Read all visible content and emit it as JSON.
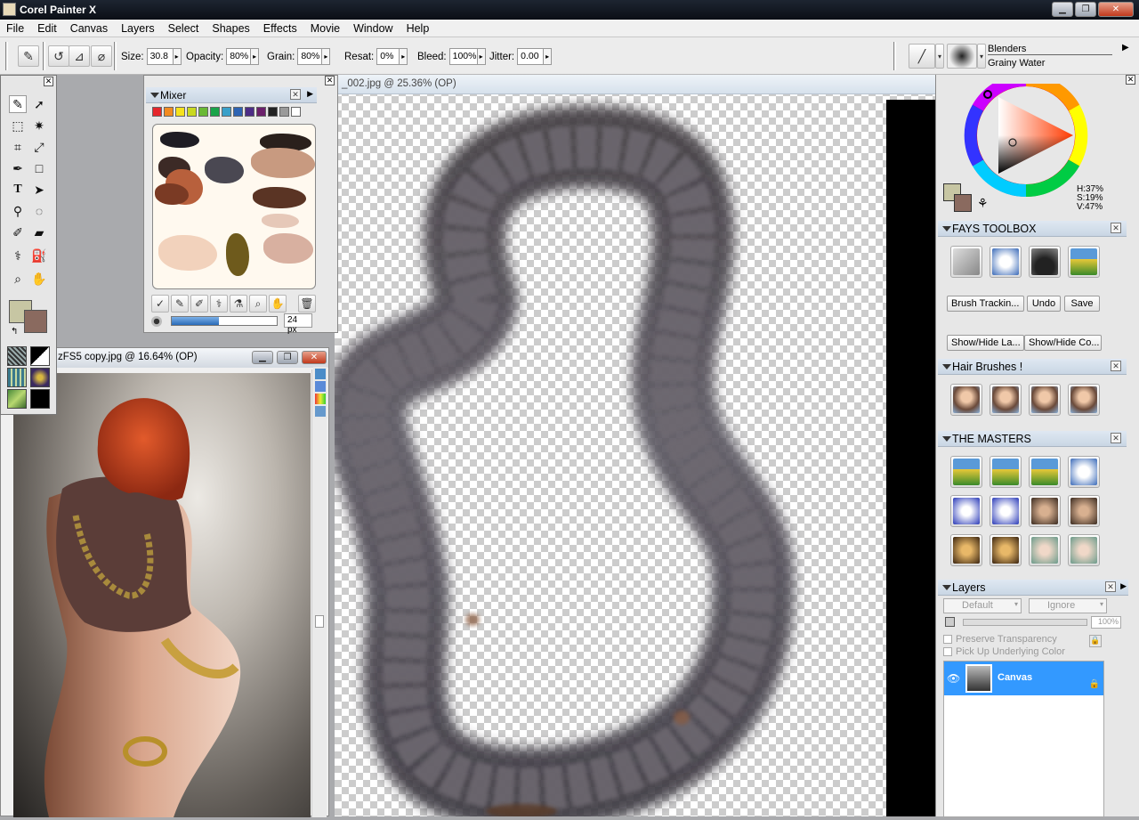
{
  "app": {
    "title": "Corel Painter X"
  },
  "menu": [
    "File",
    "Edit",
    "Canvas",
    "Layers",
    "Select",
    "Shapes",
    "Effects",
    "Movie",
    "Window",
    "Help"
  ],
  "propbar": {
    "size_label": "Size:",
    "size": "30.8",
    "opacity_label": "Opacity:",
    "opacity": "80%",
    "grain_label": "Grain:",
    "grain": "80%",
    "resat_label": "Resat:",
    "resat": "0%",
    "bleed_label": "Bleed:",
    "bleed": "100%",
    "jitter_label": "Jitter:",
    "jitter": "0.00",
    "brush_category": "Blenders",
    "brush_variant": "Grainy Water"
  },
  "documents": {
    "canvas_title": "_002.jpg @ 25.36% (OP)",
    "photo_title": "zFS5 copy.jpg @ 16.64% (OP)"
  },
  "mixer": {
    "title": "Mixer",
    "swatches": [
      "#e5262b",
      "#f28b20",
      "#f6e21c",
      "#c9d920",
      "#6ab935",
      "#1aa44a",
      "#3aa0c9",
      "#2e64b3",
      "#4d2d86",
      "#6b206b",
      "#222222",
      "#9a9a9a",
      "#ffffff"
    ],
    "brush_size": "24 px"
  },
  "color": {
    "h": "H:37%",
    "s": "S:19%",
    "v": "V:47%",
    "primary": "#c7c6a3",
    "secondary": "#8a6a5f"
  },
  "fays_toolbox": {
    "title": "FAYS TOOLBOX",
    "buttons": {
      "brush_tracking": "Brush Trackin...",
      "undo": "Undo",
      "save": "Save",
      "show_hide_layers": "Show/Hide La...",
      "show_hide_colors": "Show/Hide Co..."
    }
  },
  "hair_brushes": {
    "title": "Hair Brushes !"
  },
  "masters": {
    "title": "THE MASTERS"
  },
  "layers": {
    "title": "Layers",
    "composite_method": "Default",
    "composite_depth": "Ignore",
    "opacity": "100%",
    "preserve_transparency": "Preserve Transparency",
    "pick_up_underlying": "Pick Up Underlying Color",
    "canvas_layer": "Canvas"
  }
}
